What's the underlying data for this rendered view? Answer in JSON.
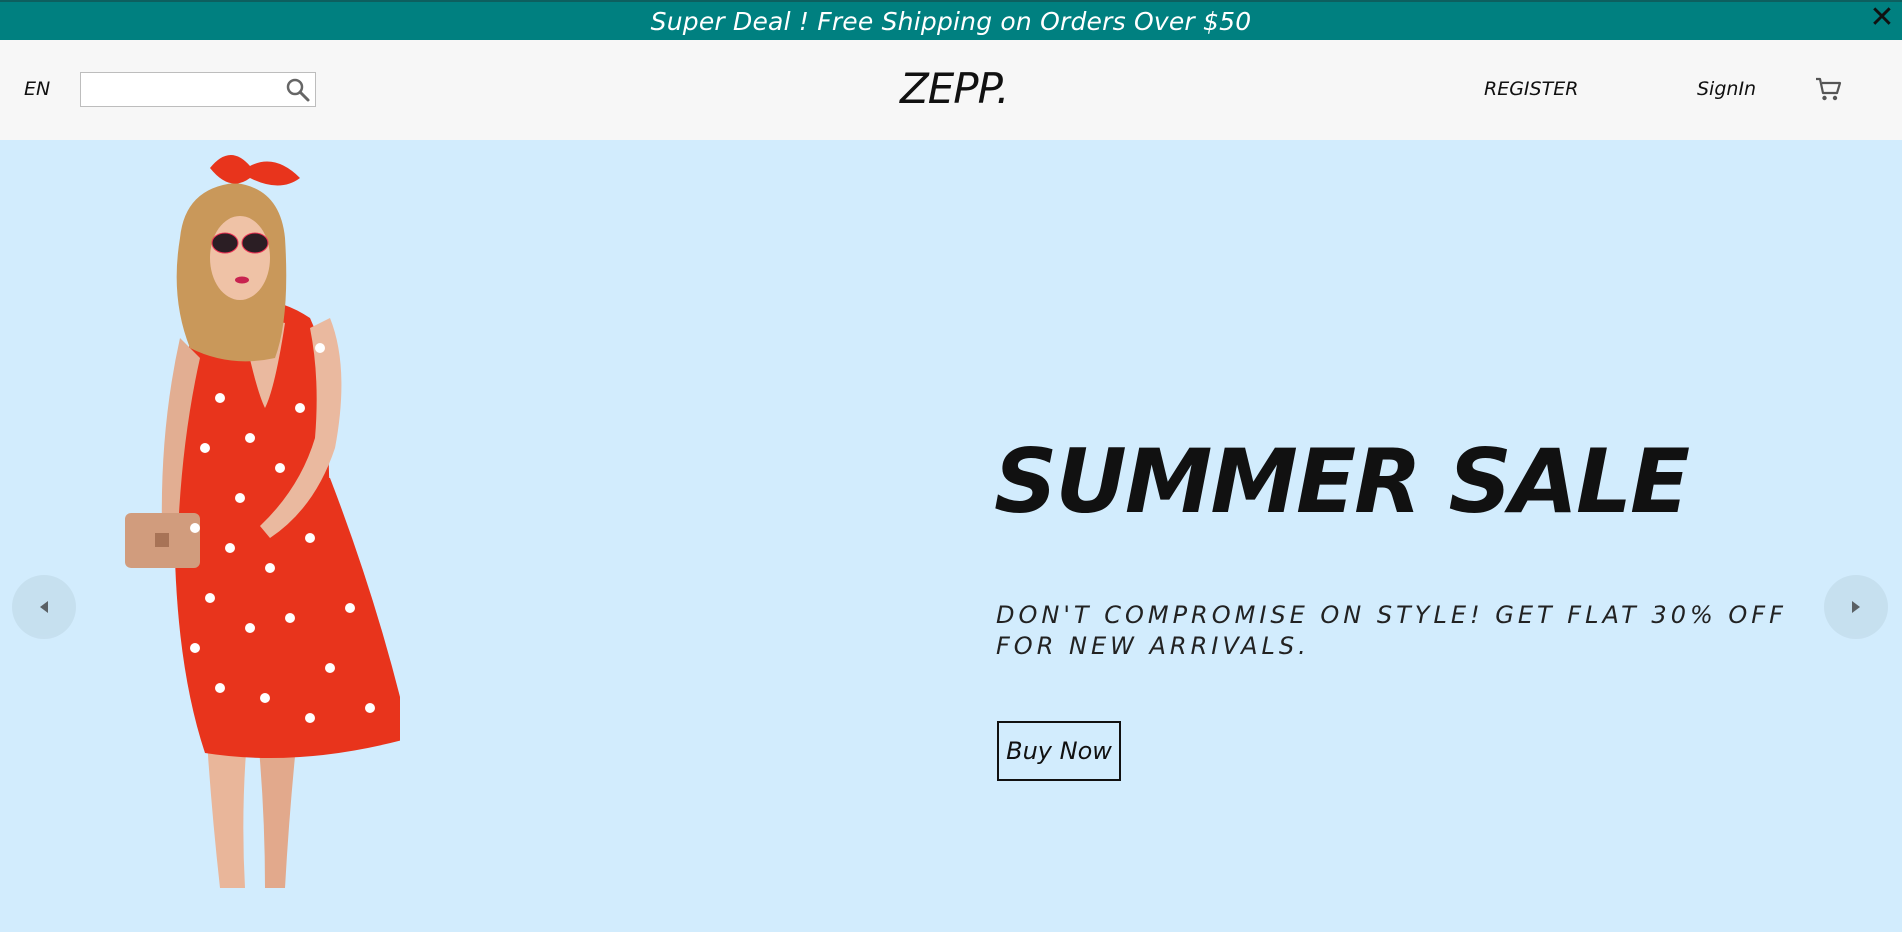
{
  "announcement": {
    "text": "Super Deal ! Free Shipping on Orders Over $50",
    "close_symbol": "✕",
    "background_color": "#008080"
  },
  "navbar": {
    "language": "EN",
    "search": {
      "placeholder": "",
      "value": "",
      "icon": "search-icon"
    },
    "logo": "ZEPP.",
    "register_label": "REGISTER",
    "signin_label": "SignIn",
    "cart_icon": "cart-icon"
  },
  "hero": {
    "title": "SUMMER SALE",
    "description": "DON'T COMPROMISE ON STYLE! GET FLAT 30% OFF FOR NEW ARRIVALS.",
    "button_label": "Buy Now",
    "background_color": "#d2ecfd",
    "prev_icon": "arrow-left-icon",
    "next_icon": "arrow-right-icon",
    "image": "woman in red polka-dot dress"
  }
}
